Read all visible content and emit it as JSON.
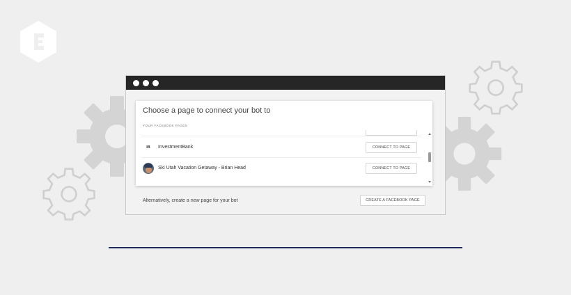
{
  "dialog": {
    "title": "Choose a page to connect your bot to",
    "section_label": "YOUR FACEBOOK PAGES"
  },
  "pages": [
    {
      "avatar_text": "IB",
      "name": "InvestmentBank",
      "button_label": "CONNECT TO PAGE"
    },
    {
      "avatar_text": "",
      "name": "Ski Utah Vacation Getaway - Brian Head",
      "button_label": "CONNECT TO PAGE"
    }
  ],
  "footer": {
    "alt_text": "Alternatively, create a new page for your bot",
    "create_button_label": "CREATE A FACEBOOK PAGE"
  },
  "colors": {
    "background": "#efefef",
    "titlebar": "#262626",
    "gear_fill": "#d4d4d4",
    "divider_rule": "#1f2b5c"
  },
  "icons": [
    "brand-logo-icon",
    "gear-icon",
    "window-dot-icon",
    "scroll-arrow-icon"
  ]
}
